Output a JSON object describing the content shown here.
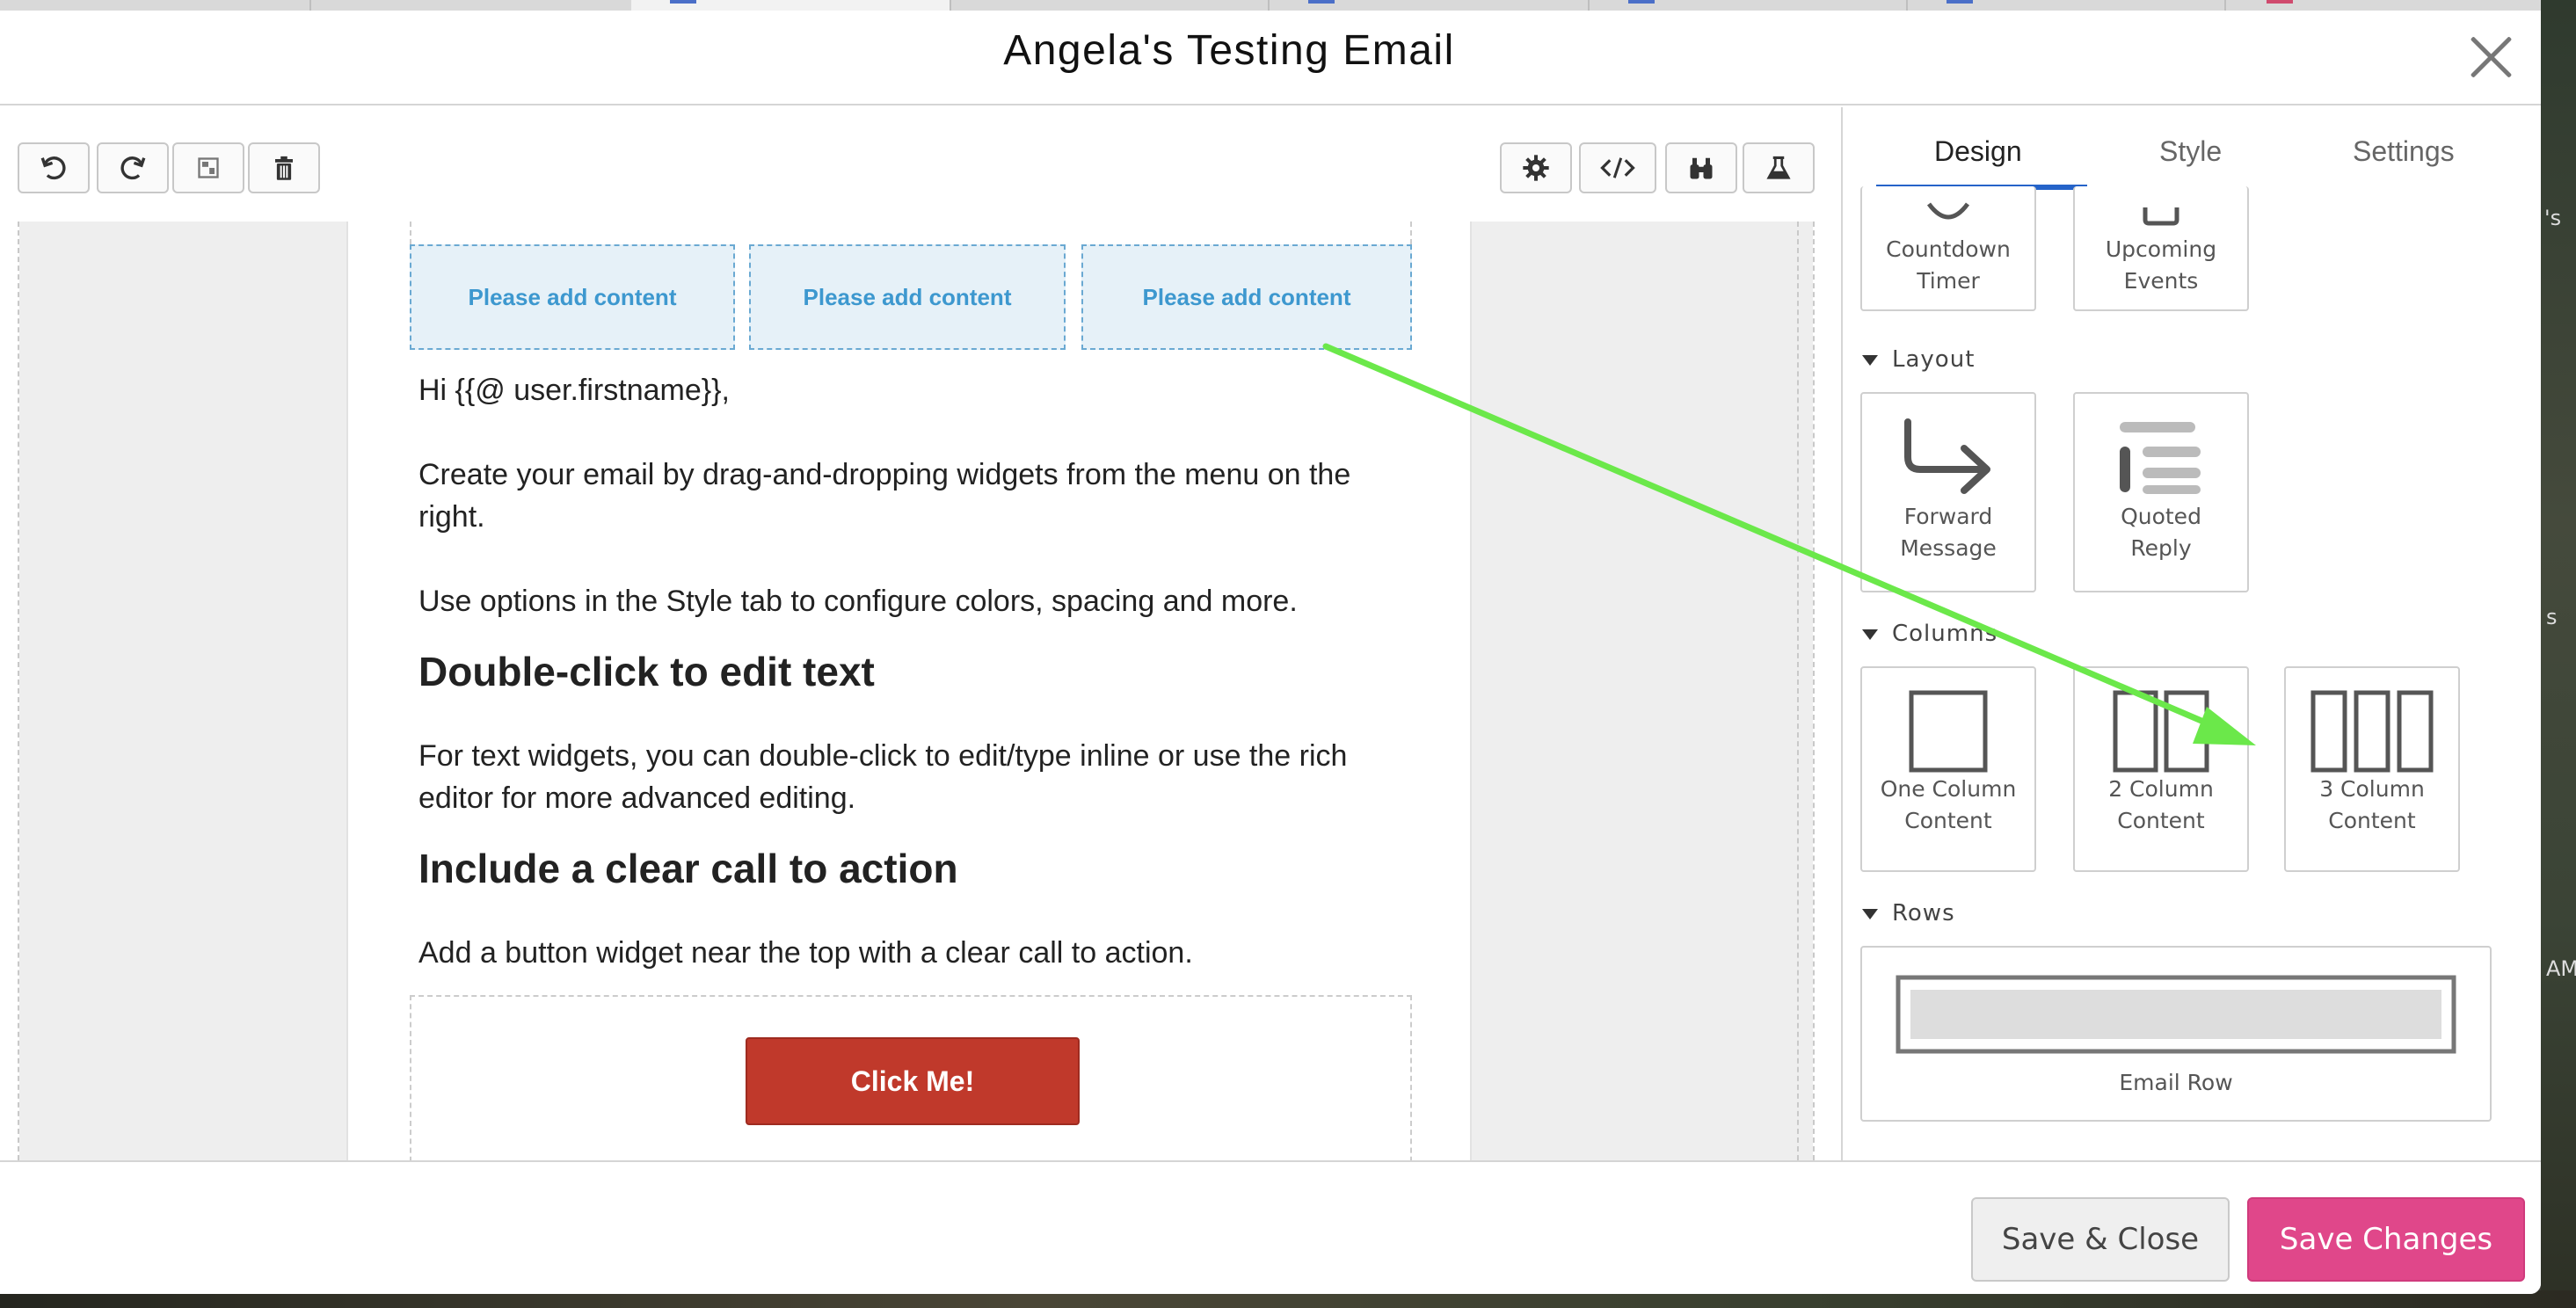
{
  "window": {
    "title": "Angela's Testing Email"
  },
  "toolbar": {
    "left_buttons": [
      "undo-icon",
      "redo-icon",
      "template-icon",
      "trash-icon"
    ],
    "right_buttons": [
      "gear-icon",
      "code-icon",
      "binoculars-icon",
      "flask-icon"
    ]
  },
  "email": {
    "column_placeholder": "Please add content",
    "greeting": "Hi {{@ user.firstname}},",
    "para1": "Create your email by drag-and-dropping widgets from the menu on the right.",
    "para2": "Use options in the Style tab to configure colors, spacing and more.",
    "heading1": "Double-click to edit text",
    "para3": "For text widgets, you can double-click to edit/type inline or use the rich editor for more advanced editing.",
    "heading2": "Include a clear call to action",
    "para4": "Add a button widget near the top with a clear call to action.",
    "cta_button": "Click Me!"
  },
  "panel": {
    "tabs": [
      "Design",
      "Style",
      "Settings"
    ],
    "active_tab": "Design",
    "top_widgets": [
      {
        "label": "Countdown Timer",
        "icon": "timer-icon"
      },
      {
        "label": "Upcoming Events",
        "icon": "calendar-icon"
      }
    ],
    "layout": {
      "title": "Layout",
      "items": [
        {
          "label": "Forward Message",
          "icon": "forward-arrow-icon"
        },
        {
          "label": "Quoted Reply",
          "icon": "quote-lines-icon"
        }
      ]
    },
    "columns": {
      "title": "Columns",
      "items": [
        {
          "label": "One Column Content",
          "icon": "one-column-icon"
        },
        {
          "label": "2 Column Content",
          "icon": "two-column-icon"
        },
        {
          "label": "3 Column Content",
          "icon": "three-column-icon"
        }
      ]
    },
    "rows": {
      "title": "Rows",
      "items": [
        {
          "label": "Email Row",
          "icon": "row-icon"
        }
      ]
    }
  },
  "footer": {
    "save_close": "Save & Close",
    "save_changes": "Save Changes"
  },
  "annotation": {
    "arrow_color": "#6be84a"
  },
  "colors": {
    "accent": "#e0478a",
    "tab_underline": "#2563c9",
    "cta": "#c0392b",
    "placeholder_text": "#3d98cf"
  },
  "edge_text": {
    "a": "'s",
    "b": "s",
    "c": "AM"
  }
}
